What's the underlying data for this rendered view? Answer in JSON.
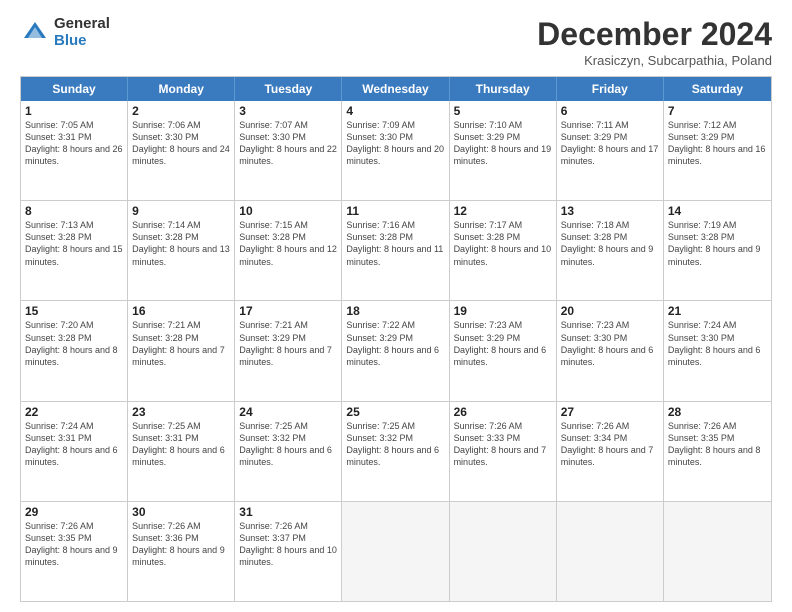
{
  "logo": {
    "general": "General",
    "blue": "Blue"
  },
  "title": "December 2024",
  "location": "Krasiczyn, Subcarpathia, Poland",
  "days": [
    "Sunday",
    "Monday",
    "Tuesday",
    "Wednesday",
    "Thursday",
    "Friday",
    "Saturday"
  ],
  "weeks": [
    [
      {
        "day": "1",
        "sunrise": "7:05 AM",
        "sunset": "3:31 PM",
        "daylight": "8 hours and 26 minutes."
      },
      {
        "day": "2",
        "sunrise": "7:06 AM",
        "sunset": "3:30 PM",
        "daylight": "8 hours and 24 minutes."
      },
      {
        "day": "3",
        "sunrise": "7:07 AM",
        "sunset": "3:30 PM",
        "daylight": "8 hours and 22 minutes."
      },
      {
        "day": "4",
        "sunrise": "7:09 AM",
        "sunset": "3:30 PM",
        "daylight": "8 hours and 20 minutes."
      },
      {
        "day": "5",
        "sunrise": "7:10 AM",
        "sunset": "3:29 PM",
        "daylight": "8 hours and 19 minutes."
      },
      {
        "day": "6",
        "sunrise": "7:11 AM",
        "sunset": "3:29 PM",
        "daylight": "8 hours and 17 minutes."
      },
      {
        "day": "7",
        "sunrise": "7:12 AM",
        "sunset": "3:29 PM",
        "daylight": "8 hours and 16 minutes."
      }
    ],
    [
      {
        "day": "8",
        "sunrise": "7:13 AM",
        "sunset": "3:28 PM",
        "daylight": "8 hours and 15 minutes."
      },
      {
        "day": "9",
        "sunrise": "7:14 AM",
        "sunset": "3:28 PM",
        "daylight": "8 hours and 13 minutes."
      },
      {
        "day": "10",
        "sunrise": "7:15 AM",
        "sunset": "3:28 PM",
        "daylight": "8 hours and 12 minutes."
      },
      {
        "day": "11",
        "sunrise": "7:16 AM",
        "sunset": "3:28 PM",
        "daylight": "8 hours and 11 minutes."
      },
      {
        "day": "12",
        "sunrise": "7:17 AM",
        "sunset": "3:28 PM",
        "daylight": "8 hours and 10 minutes."
      },
      {
        "day": "13",
        "sunrise": "7:18 AM",
        "sunset": "3:28 PM",
        "daylight": "8 hours and 9 minutes."
      },
      {
        "day": "14",
        "sunrise": "7:19 AM",
        "sunset": "3:28 PM",
        "daylight": "8 hours and 9 minutes."
      }
    ],
    [
      {
        "day": "15",
        "sunrise": "7:20 AM",
        "sunset": "3:28 PM",
        "daylight": "8 hours and 8 minutes."
      },
      {
        "day": "16",
        "sunrise": "7:21 AM",
        "sunset": "3:28 PM",
        "daylight": "8 hours and 7 minutes."
      },
      {
        "day": "17",
        "sunrise": "7:21 AM",
        "sunset": "3:29 PM",
        "daylight": "8 hours and 7 minutes."
      },
      {
        "day": "18",
        "sunrise": "7:22 AM",
        "sunset": "3:29 PM",
        "daylight": "8 hours and 6 minutes."
      },
      {
        "day": "19",
        "sunrise": "7:23 AM",
        "sunset": "3:29 PM",
        "daylight": "8 hours and 6 minutes."
      },
      {
        "day": "20",
        "sunrise": "7:23 AM",
        "sunset": "3:30 PM",
        "daylight": "8 hours and 6 minutes."
      },
      {
        "day": "21",
        "sunrise": "7:24 AM",
        "sunset": "3:30 PM",
        "daylight": "8 hours and 6 minutes."
      }
    ],
    [
      {
        "day": "22",
        "sunrise": "7:24 AM",
        "sunset": "3:31 PM",
        "daylight": "8 hours and 6 minutes."
      },
      {
        "day": "23",
        "sunrise": "7:25 AM",
        "sunset": "3:31 PM",
        "daylight": "8 hours and 6 minutes."
      },
      {
        "day": "24",
        "sunrise": "7:25 AM",
        "sunset": "3:32 PM",
        "daylight": "8 hours and 6 minutes."
      },
      {
        "day": "25",
        "sunrise": "7:25 AM",
        "sunset": "3:32 PM",
        "daylight": "8 hours and 6 minutes."
      },
      {
        "day": "26",
        "sunrise": "7:26 AM",
        "sunset": "3:33 PM",
        "daylight": "8 hours and 7 minutes."
      },
      {
        "day": "27",
        "sunrise": "7:26 AM",
        "sunset": "3:34 PM",
        "daylight": "8 hours and 7 minutes."
      },
      {
        "day": "28",
        "sunrise": "7:26 AM",
        "sunset": "3:35 PM",
        "daylight": "8 hours and 8 minutes."
      }
    ],
    [
      {
        "day": "29",
        "sunrise": "7:26 AM",
        "sunset": "3:35 PM",
        "daylight": "8 hours and 9 minutes."
      },
      {
        "day": "30",
        "sunrise": "7:26 AM",
        "sunset": "3:36 PM",
        "daylight": "8 hours and 9 minutes."
      },
      {
        "day": "31",
        "sunrise": "7:26 AM",
        "sunset": "3:37 PM",
        "daylight": "8 hours and 10 minutes."
      },
      null,
      null,
      null,
      null
    ]
  ]
}
